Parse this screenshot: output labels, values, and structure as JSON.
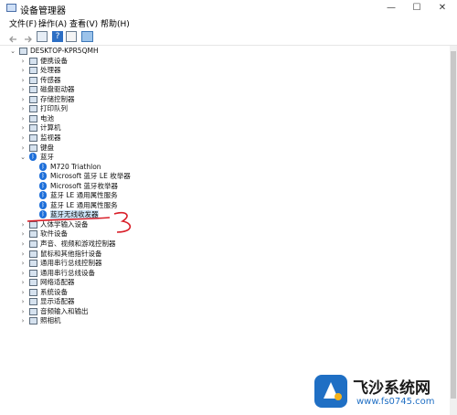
{
  "window": {
    "title": "设备管理器",
    "minimize": "—",
    "maximize": "☐",
    "close": "✕"
  },
  "menu": [
    {
      "label": "文件(F)"
    },
    {
      "label": "操作(A)"
    },
    {
      "label": "查看(V)"
    },
    {
      "label": "帮助(H)"
    }
  ],
  "toolbar": {
    "buttons": [
      {
        "icon": "back-arrow-icon"
      },
      {
        "icon": "forward-arrow-icon"
      },
      {
        "icon": "view-properties-icon"
      },
      {
        "icon": "help-icon"
      },
      {
        "icon": "view-list-icon"
      },
      {
        "icon": "monitor-scan-icon"
      }
    ]
  },
  "tree": {
    "root": "DESKTOP-KPR5QMH",
    "categories": [
      "便携设备",
      "处理器",
      "传感器",
      "磁盘驱动器",
      "存储控制器",
      "打印队列",
      "电池",
      "计算机",
      "监视器",
      "键盘",
      "蓝牙"
    ],
    "bluetooth_children": [
      "M720 Triathlon",
      "Microsoft 蓝牙 LE 枚举器",
      "Microsoft 蓝牙枚举器",
      "蓝牙 LE 通用属性服务",
      "蓝牙 LE 通用属性服务",
      "蓝牙无线收发器"
    ],
    "categories_after": [
      "人体学输入设备",
      "软件设备",
      "声音、视频和游戏控制器",
      "鼠标和其他指针设备",
      "通用串行总线控制器",
      "通用串行总线设备",
      "网络适配器",
      "系统设备",
      "显示适配器",
      "音频输入和输出",
      "照相机"
    ]
  },
  "annotation": {
    "number": "3",
    "color": "#d9202a"
  },
  "watermark": {
    "title": "飞沙系统网",
    "url": "www.fs0745.com"
  }
}
